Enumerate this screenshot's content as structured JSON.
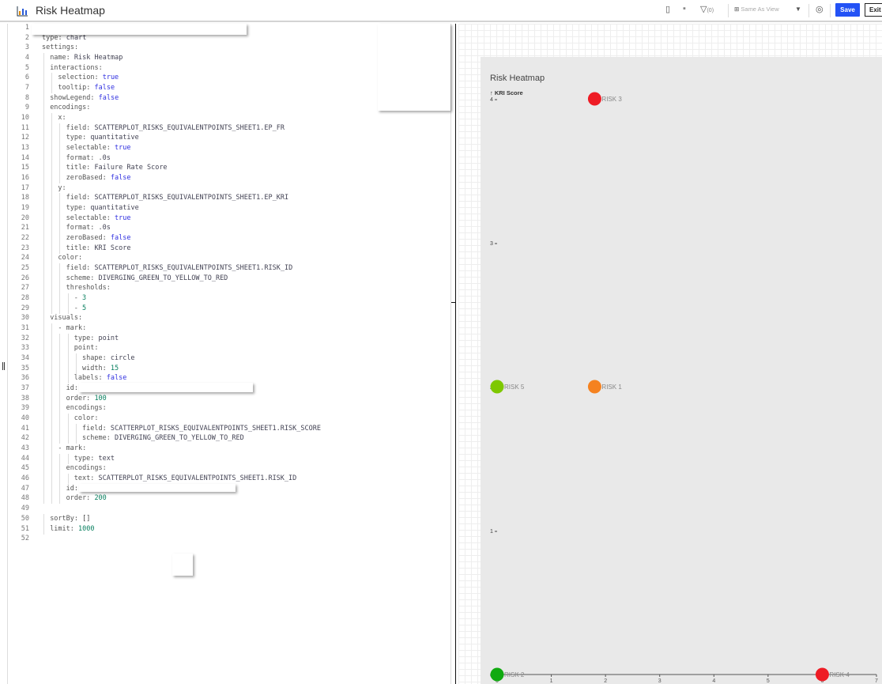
{
  "header": {
    "title": "Risk Heatmap",
    "filter_count": "(0)",
    "view_select": "Same As View",
    "save_label": "Save",
    "exit_label": "Exit"
  },
  "editor": {
    "lines": [
      {
        "n": "1",
        "i": 0,
        "k": "id:",
        "v": "",
        "t": "s"
      },
      {
        "n": "2",
        "i": 0,
        "k": "type:",
        "v": "chart",
        "t": "s"
      },
      {
        "n": "3",
        "i": 0,
        "k": "settings:",
        "v": "",
        "t": "s"
      },
      {
        "n": "4",
        "i": 1,
        "k": "name:",
        "v": "Risk Heatmap",
        "t": "s"
      },
      {
        "n": "5",
        "i": 1,
        "k": "interactions:",
        "v": "",
        "t": "s"
      },
      {
        "n": "6",
        "i": 2,
        "k": "selection:",
        "v": "true",
        "t": "b"
      },
      {
        "n": "7",
        "i": 2,
        "k": "tooltip:",
        "v": "false",
        "t": "b"
      },
      {
        "n": "8",
        "i": 1,
        "k": "showLegend:",
        "v": "false",
        "t": "b"
      },
      {
        "n": "9",
        "i": 1,
        "k": "encodings:",
        "v": "",
        "t": "s"
      },
      {
        "n": "10",
        "i": 2,
        "k": "x:",
        "v": "",
        "t": "s"
      },
      {
        "n": "11",
        "i": 3,
        "k": "field:",
        "v": "SCATTERPLOT_RISKS_EQUIVALENTPOINTS_SHEET1.EP_FR",
        "t": "s"
      },
      {
        "n": "12",
        "i": 3,
        "k": "type:",
        "v": "quantitative",
        "t": "s"
      },
      {
        "n": "13",
        "i": 3,
        "k": "selectable:",
        "v": "true",
        "t": "b"
      },
      {
        "n": "14",
        "i": 3,
        "k": "format:",
        "v": ".0s",
        "t": "s"
      },
      {
        "n": "15",
        "i": 3,
        "k": "title:",
        "v": "Failure Rate Score",
        "t": "s"
      },
      {
        "n": "16",
        "i": 3,
        "k": "zeroBased:",
        "v": "false",
        "t": "b"
      },
      {
        "n": "17",
        "i": 2,
        "k": "y:",
        "v": "",
        "t": "s"
      },
      {
        "n": "18",
        "i": 3,
        "k": "field:",
        "v": "SCATTERPLOT_RISKS_EQUIVALENTPOINTS_SHEET1.EP_KRI",
        "t": "s"
      },
      {
        "n": "19",
        "i": 3,
        "k": "type:",
        "v": "quantitative",
        "t": "s"
      },
      {
        "n": "20",
        "i": 3,
        "k": "selectable:",
        "v": "true",
        "t": "b"
      },
      {
        "n": "21",
        "i": 3,
        "k": "format:",
        "v": ".0s",
        "t": "s"
      },
      {
        "n": "22",
        "i": 3,
        "k": "zeroBased:",
        "v": "false",
        "t": "b"
      },
      {
        "n": "23",
        "i": 3,
        "k": "title:",
        "v": "KRI Score",
        "t": "s"
      },
      {
        "n": "24",
        "i": 2,
        "k": "color:",
        "v": "",
        "t": "s"
      },
      {
        "n": "25",
        "i": 3,
        "k": "field:",
        "v": "SCATTERPLOT_RISKS_EQUIVALENTPOINTS_SHEET1.RISK_ID",
        "t": "s"
      },
      {
        "n": "26",
        "i": 3,
        "k": "scheme:",
        "v": "DIVERGING_GREEN_TO_YELLOW_TO_RED",
        "t": "s"
      },
      {
        "n": "27",
        "i": 3,
        "k": "thresholds:",
        "v": "",
        "t": "s"
      },
      {
        "n": "28",
        "i": 4,
        "k": "-",
        "v": "3",
        "t": "n"
      },
      {
        "n": "29",
        "i": 4,
        "k": "-",
        "v": "5",
        "t": "n"
      },
      {
        "n": "30",
        "i": 1,
        "k": "visuals:",
        "v": "",
        "t": "s"
      },
      {
        "n": "31",
        "i": 2,
        "k": "- mark:",
        "v": "",
        "t": "s"
      },
      {
        "n": "32",
        "i": 4,
        "k": "type:",
        "v": "point",
        "t": "s"
      },
      {
        "n": "33",
        "i": 4,
        "k": "point:",
        "v": "",
        "t": "s"
      },
      {
        "n": "34",
        "i": 5,
        "k": "shape:",
        "v": "circle",
        "t": "s"
      },
      {
        "n": "35",
        "i": 5,
        "k": "width:",
        "v": "15",
        "t": "n"
      },
      {
        "n": "36",
        "i": 4,
        "k": "labels:",
        "v": "false",
        "t": "b"
      },
      {
        "n": "37",
        "i": 3,
        "k": "id:",
        "v": "",
        "t": "s"
      },
      {
        "n": "38",
        "i": 3,
        "k": "order:",
        "v": "100",
        "t": "n"
      },
      {
        "n": "39",
        "i": 3,
        "k": "encodings:",
        "v": "",
        "t": "s"
      },
      {
        "n": "40",
        "i": 4,
        "k": "color:",
        "v": "",
        "t": "s"
      },
      {
        "n": "41",
        "i": 5,
        "k": "field:",
        "v": "SCATTERPLOT_RISKS_EQUIVALENTPOINTS_SHEET1.RISK_SCORE",
        "t": "s"
      },
      {
        "n": "42",
        "i": 5,
        "k": "scheme:",
        "v": "DIVERGING_GREEN_TO_YELLOW_TO_RED",
        "t": "s"
      },
      {
        "n": "43",
        "i": 2,
        "k": "- mark:",
        "v": "",
        "t": "s"
      },
      {
        "n": "44",
        "i": 4,
        "k": "type:",
        "v": "text",
        "t": "s"
      },
      {
        "n": "45",
        "i": 3,
        "k": "encodings:",
        "v": "",
        "t": "s"
      },
      {
        "n": "46",
        "i": 4,
        "k": "text:",
        "v": "SCATTERPLOT_RISKS_EQUIVALENTPOINTS_SHEET1.RISK_ID",
        "t": "s"
      },
      {
        "n": "47",
        "i": 3,
        "k": "id:",
        "v": "",
        "t": "s"
      },
      {
        "n": "48",
        "i": 3,
        "k": "order:",
        "v": "200",
        "t": "n"
      },
      {
        "n": "49",
        "i": 0,
        "k": "",
        "v": "",
        "t": "s"
      },
      {
        "n": "50",
        "i": 1,
        "k": "sortBy:",
        "v": "[]",
        "t": "p"
      },
      {
        "n": "51",
        "i": 1,
        "k": "limit:",
        "v": "1000",
        "t": "n"
      },
      {
        "n": "52",
        "i": 0,
        "k": "",
        "v": "",
        "t": "s"
      }
    ]
  },
  "chart_data": {
    "type": "scatter",
    "title": "Risk Heatmap",
    "ylabel": "↑ KRI Score",
    "xlabel": "",
    "xlim": [
      0,
      7
    ],
    "ylim": [
      0,
      4
    ],
    "xticks": [
      "0",
      "1",
      "2",
      "3",
      "4",
      "5",
      "6",
      "7"
    ],
    "yticks": [
      "0",
      "1",
      "2",
      "3",
      "4"
    ],
    "grid": false,
    "legend": "none",
    "points": [
      {
        "label": "RISK 3",
        "x": 1.8,
        "y": 4,
        "color": "#ee1c25"
      },
      {
        "label": "RISK 5",
        "x": 0,
        "y": 2,
        "color": "#7ec800"
      },
      {
        "label": "RISK 1",
        "x": 1.8,
        "y": 2,
        "color": "#f58220"
      },
      {
        "label": "RISK 2",
        "x": 0,
        "y": 0,
        "color": "#10aa10"
      },
      {
        "label": "RISK 4",
        "x": 6,
        "y": 0,
        "color": "#ee1c25"
      }
    ]
  }
}
